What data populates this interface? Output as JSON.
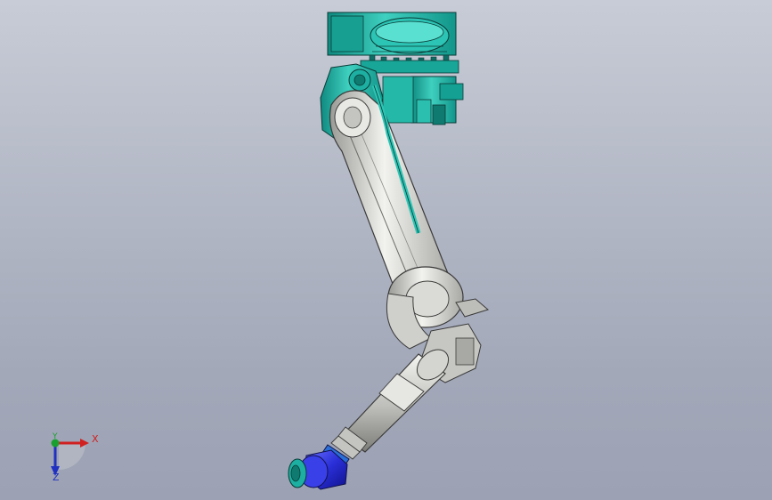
{
  "viewport": {
    "background_top": "#c8ccd6",
    "background_bottom": "#9ca2b4"
  },
  "model": {
    "base_color": "#1fb0a0",
    "arm_color": "#d8d8d4",
    "arm_outline": "#3a3a3a",
    "wrist_color": "#2a2fd8",
    "flange_color": "#20b0a0"
  },
  "triad": {
    "x_label": "X",
    "y_label": "Y",
    "z_label": "Z",
    "x_color": "#d02020",
    "y_color": "#1aa030",
    "z_color": "#2030c0",
    "icon": "axis-triad-icon"
  }
}
